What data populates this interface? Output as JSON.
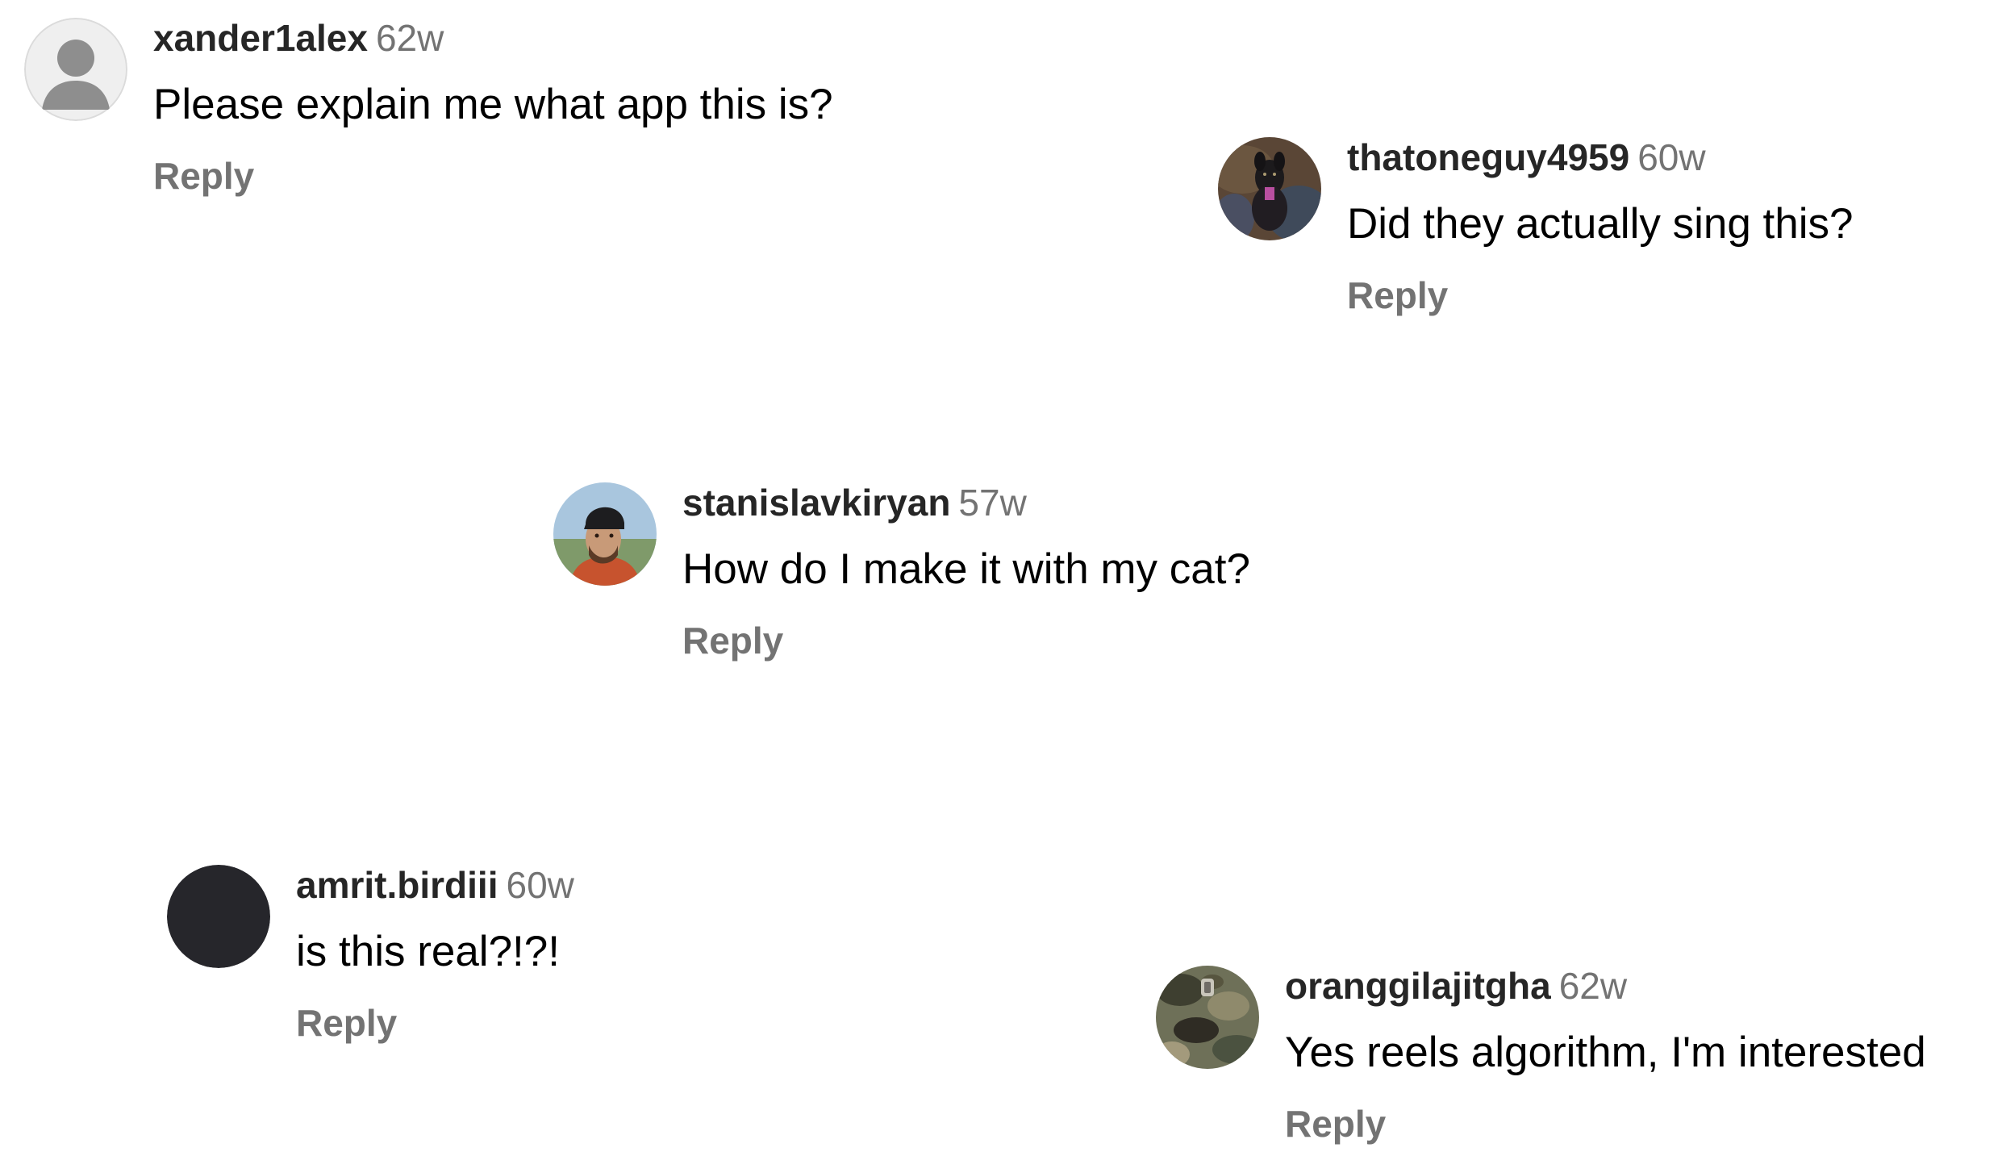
{
  "comments": [
    {
      "username": "xander1alex",
      "time": "62w",
      "text": "Please explain me what app this is?",
      "reply": "Reply",
      "avatar": "default-person-icon"
    },
    {
      "username": "thatoneguy4959",
      "time": "60w",
      "text": "Did they actually sing this?",
      "reply": "Reply",
      "avatar": "dog-photo"
    },
    {
      "username": "stanislavkiryan",
      "time": "57w",
      "text": "How do I make it with my cat?",
      "reply": "Reply",
      "avatar": "man-in-hat-photo"
    },
    {
      "username": "amrit.birdiii",
      "time": "60w",
      "text": "is this real?!?!",
      "reply": "Reply",
      "avatar": "black-circle"
    },
    {
      "username": "oranggilajitgha",
      "time": "62w",
      "text": "Yes reels algorithm, I'm interested",
      "reply": "Reply",
      "avatar": "camo-photo"
    }
  ]
}
